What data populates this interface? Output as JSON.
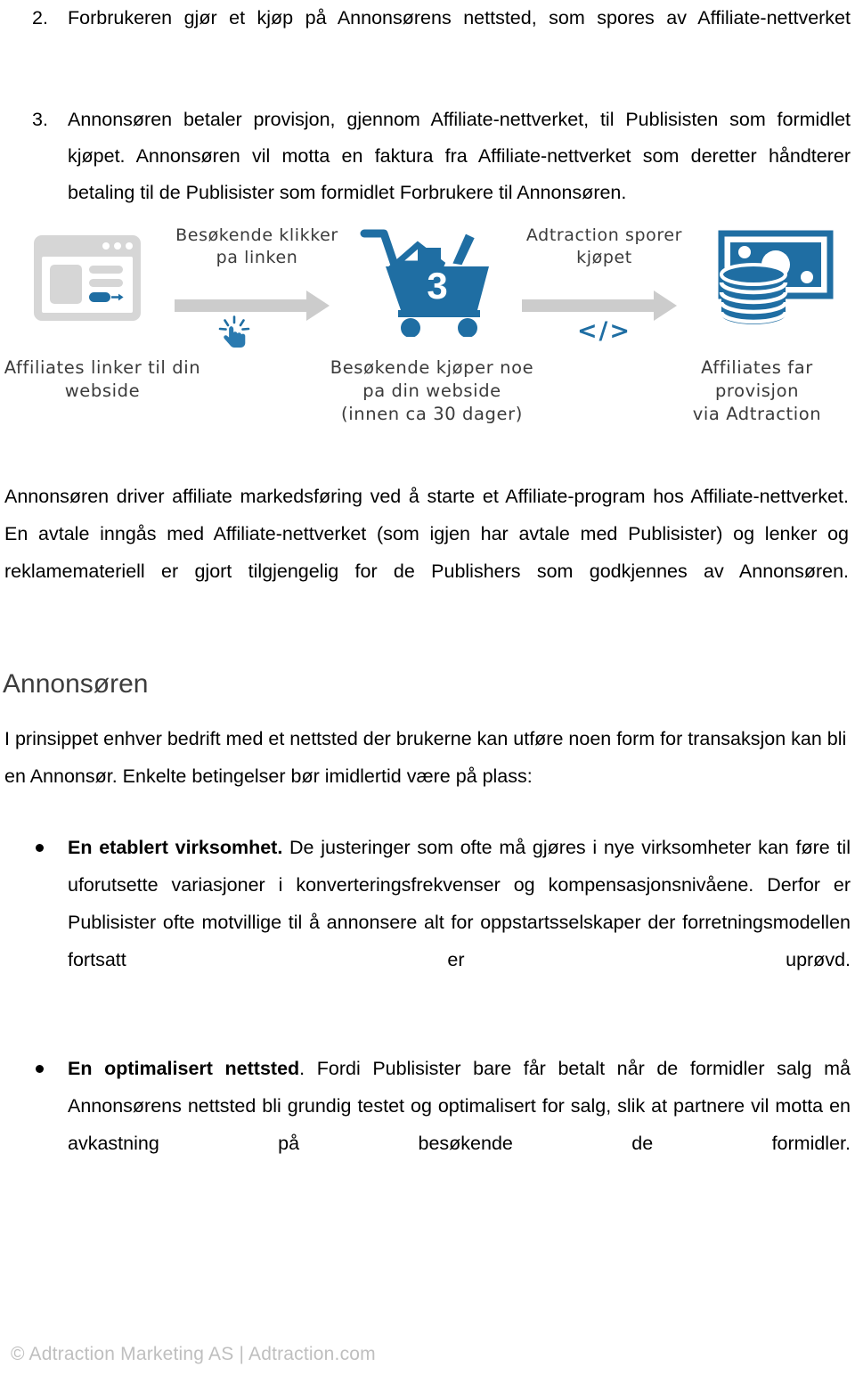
{
  "document": {
    "numbered_list": [
      {
        "number": "2.",
        "text": "Forbrukeren gjør et kjøp på Annonsørens nettsted, som spores av Affiliate-nettverket"
      },
      {
        "number": "3.",
        "text": "Annonsøren betaler provisjon, gjennom Affiliate-nettverket, til Publisisten som formidlet kjøpet. Annonsøren vil motta en faktura fra Affiliate-nettverket som deretter håndterer betaling til de Publisister som formidlet Forbrukere til Annonsøren."
      }
    ],
    "illustration": {
      "step1": {
        "icon": "browser-window-icon",
        "caption": "Affiliates linker til din\nwebside"
      },
      "arrow1": {
        "label": "Besøkende klikker\npa linken",
        "icon": "click-cursor-icon"
      },
      "step2": {
        "icon": "shopping-cart-icon",
        "badge": "3",
        "caption": "Besøkende kjøper noe\npa din webside\n(innen ca 30 dager)"
      },
      "arrow2": {
        "label": "Adtraction sporer\nkjøpet",
        "icon": "code-tag-icon",
        "code": "</>"
      },
      "step3": {
        "icon": "money-coins-icon",
        "caption": "Affiliates far provisjon\nvia Adtraction"
      },
      "colors": {
        "accent_blue": "#1f6ea3",
        "gray": "#cccccc",
        "browser_gray": "#d6d6d6",
        "hand_text": "#3b3b3b"
      }
    },
    "paragraph_affiliate": "Annonsøren driver affiliate markedsføring ved å starte et Affiliate-program hos Affiliate-nettverket. En avtale inngås med Affiliate-nettverket (som igjen har avtale med Publisister) og lenker og reklamemateriell er gjort tilgjengelig for de Publishers som godkjennes av Annonsøren.",
    "heading": "Annonsøren",
    "paragraph_intro": "I prinsippet enhver bedrift med et nettsted der brukerne kan utføre noen form for transaksjon kan bli en Annonsør. Enkelte betingelser bør imidlertid være på plass:",
    "bullets": [
      {
        "lead": "En etablert virksomhet.",
        "text": " De justeringer som ofte må gjøres i nye virksomheter kan føre til uforutsette variasjoner i konverteringsfrekvenser og kompensasjonsnivåene. Derfor er Publisister ofte motvillige til å annonsere alt for oppstartsselskaper der forretningsmodellen fortsatt er uprøvd."
      },
      {
        "lead": "En optimalisert nettsted",
        "text": ". Fordi Publisister bare får betalt når de formidler salg må Annonsørens nettsted bli grundig testet og optimalisert for salg, slik at partnere vil motta en avkastning på besøkende de formidler."
      }
    ],
    "footer": "© Adtraction Marketing AS | Adtraction.com"
  }
}
